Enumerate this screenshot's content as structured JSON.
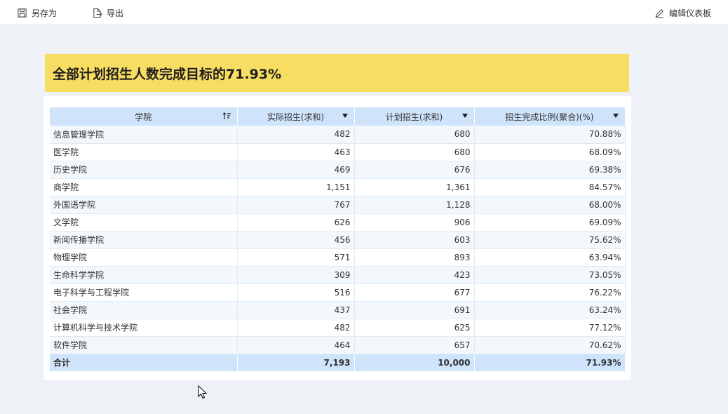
{
  "toolbar": {
    "save_as": "另存为",
    "export": "导出",
    "edit_dashboard": "编辑仪表板"
  },
  "headline": "全部计划招生人数完成目标的71.93%",
  "table": {
    "columns": [
      "学院",
      "实际招生(求和)",
      "计划招生(求和)",
      "招生完成比例(聚合)(%)"
    ],
    "rows": [
      {
        "college": "信息管理学院",
        "actual": "482",
        "plan": "680",
        "ratio": "70.88%"
      },
      {
        "college": "医学院",
        "actual": "463",
        "plan": "680",
        "ratio": "68.09%"
      },
      {
        "college": "历史学院",
        "actual": "469",
        "plan": "676",
        "ratio": "69.38%"
      },
      {
        "college": "商学院",
        "actual": "1,151",
        "plan": "1,361",
        "ratio": "84.57%"
      },
      {
        "college": "外国语学院",
        "actual": "767",
        "plan": "1,128",
        "ratio": "68.00%"
      },
      {
        "college": "文学院",
        "actual": "626",
        "plan": "906",
        "ratio": "69.09%"
      },
      {
        "college": "新闻传播学院",
        "actual": "456",
        "plan": "603",
        "ratio": "75.62%"
      },
      {
        "college": "物理学院",
        "actual": "571",
        "plan": "893",
        "ratio": "63.94%"
      },
      {
        "college": "生命科学学院",
        "actual": "309",
        "plan": "423",
        "ratio": "73.05%"
      },
      {
        "college": "电子科学与工程学院",
        "actual": "516",
        "plan": "677",
        "ratio": "76.22%"
      },
      {
        "college": "社会学院",
        "actual": "437",
        "plan": "691",
        "ratio": "63.24%"
      },
      {
        "college": "计算机科学与技术学院",
        "actual": "482",
        "plan": "625",
        "ratio": "77.12%"
      },
      {
        "college": "软件学院",
        "actual": "464",
        "plan": "657",
        "ratio": "70.62%"
      }
    ],
    "total": {
      "college": "合计",
      "actual": "7,193",
      "plan": "10,000",
      "ratio": "71.93%"
    }
  },
  "icons": {
    "save_as": "save-icon",
    "export": "export-icon",
    "edit": "edit-pencil-icon",
    "sort": "sort-icon",
    "dropdown": "dropdown-caret-icon",
    "cursor": "mouse-cursor-icon"
  }
}
